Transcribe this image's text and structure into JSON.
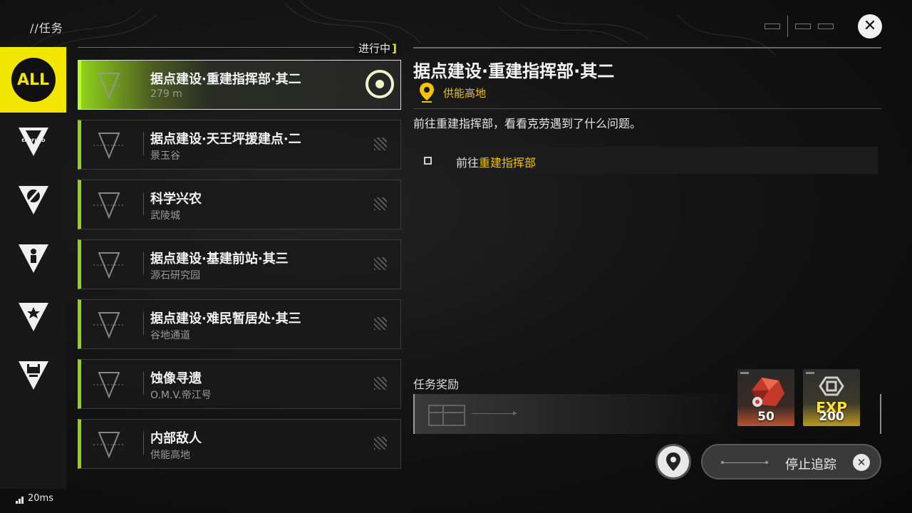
{
  "header": {
    "breadcrumb": "//任务"
  },
  "sidebar": {
    "items": [
      {
        "name": "all",
        "label": "ALL",
        "active": true
      },
      {
        "name": "endfield",
        "label": "ENDFIELD",
        "icon": "endfield-triangle-icon"
      },
      {
        "name": "cross",
        "icon": "cross-triangle-icon"
      },
      {
        "name": "person",
        "icon": "person-triangle-icon"
      },
      {
        "name": "star",
        "icon": "star-triangle-icon"
      },
      {
        "name": "gear",
        "icon": "gear-triangle-icon"
      }
    ]
  },
  "list": {
    "status_label": "进行中",
    "quests": [
      {
        "title": "据点建设·重建指挥部·其二",
        "subtitle": "279 m",
        "active": true
      },
      {
        "title": "据点建设·天王坪援建点·二",
        "subtitle": "景玉谷"
      },
      {
        "title": "科学兴农",
        "subtitle": "武陵城"
      },
      {
        "title": "据点建设·基建前站·其三",
        "subtitle": "源石研究园"
      },
      {
        "title": "据点建设·难民暂居处·其三",
        "subtitle": "谷地通道"
      },
      {
        "title": "蚀像寻遗",
        "subtitle": "O.M.V.帝江号"
      },
      {
        "title": "内部敌人",
        "subtitle": "供能高地"
      }
    ]
  },
  "detail": {
    "title": "据点建设·重建指挥部·其二",
    "location": "供能高地",
    "description": "前往重建指挥部，看看克劳遇到了什么问题。",
    "objective_prefix": "前往",
    "objective_target": "重建指挥部"
  },
  "reward": {
    "label": "任务奖励",
    "items": [
      {
        "icon": "red-crystal-icon",
        "quantity": "50"
      },
      {
        "icon": "exp-icon",
        "label": "EXP",
        "quantity": "200"
      }
    ]
  },
  "actions": {
    "stop_tracking": "停止追踪"
  },
  "footer": {
    "ping": "20ms"
  },
  "colors": {
    "accent_yellow": "#f2e600",
    "accent_green": "#8fd11b",
    "location_gold": "#f2c300"
  }
}
